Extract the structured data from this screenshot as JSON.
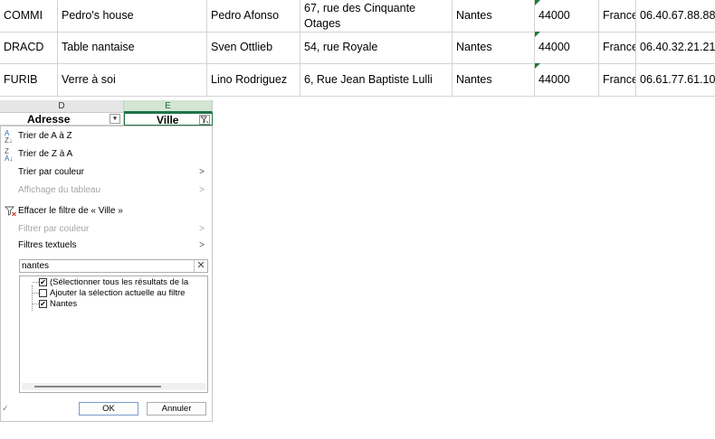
{
  "rows": [
    {
      "id": "COMMI",
      "company": "Pedro's house",
      "contact": "Pedro Afonso",
      "address": "67, rue des Cinquante Otages",
      "city": "Nantes",
      "postal": "44000",
      "country": "France",
      "phone": "06.40.67.88.88"
    },
    {
      "id": "DRACD",
      "company": "Table nantaise",
      "contact": "Sven Ottlieb",
      "address": "54, rue Royale",
      "city": "Nantes",
      "postal": "44000",
      "country": "France",
      "phone": "06.40.32.21.21"
    },
    {
      "id": "FURIB",
      "company": "Verre à soi",
      "contact": "Lino Rodriguez",
      "address": "6, Rue Jean Baptiste Lulli",
      "city": "Nantes",
      "postal": "44000",
      "country": "France",
      "phone": "06.61.77.61.10"
    }
  ],
  "columns": {
    "d_letter": "D",
    "e_letter": "E",
    "d_header": "Adresse",
    "e_header": "Ville"
  },
  "filter_menu": {
    "sort_az": "Trier de A à Z",
    "sort_za": "Trier de Z à A",
    "sort_by_color": "Trier par couleur",
    "table_view": "Affichage du tableau",
    "clear_filter": "Effacer le filtre de « Ville »",
    "filter_by_color": "Filtrer par couleur",
    "text_filters": "Filtres textuels",
    "search_value": "nantes",
    "options": [
      {
        "label": "(Sélectionner tous les résultats de la",
        "checked": true
      },
      {
        "label": "Ajouter la sélection actuelle au filtre",
        "checked": false
      },
      {
        "label": "Nantes",
        "checked": true
      }
    ],
    "ok": "OK",
    "cancel": "Annuler"
  },
  "colors": {
    "accent": "#217346",
    "error_triangle": "#1e7b34",
    "clear_filter_x": "#c0392b"
  }
}
